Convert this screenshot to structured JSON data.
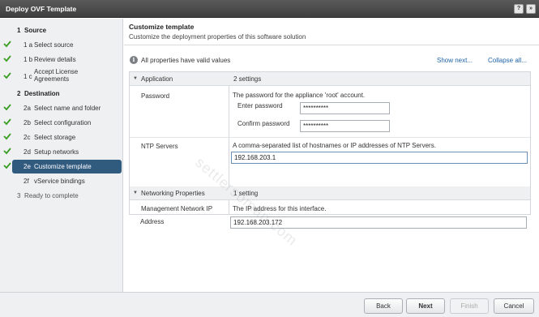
{
  "window": {
    "title": "Deploy OVF Template",
    "help_glyph": "?",
    "close_glyph": "»"
  },
  "steps": [
    {
      "num": "1",
      "label": "Source",
      "kind": "head",
      "checked": false
    },
    {
      "num": "1 a",
      "label": "Select source",
      "kind": "sub",
      "checked": true
    },
    {
      "num": "1 b",
      "label": "Review details",
      "kind": "sub",
      "checked": true
    },
    {
      "num": "1 c",
      "label": "Accept License Agreements",
      "kind": "sub",
      "checked": true
    },
    {
      "num": "2",
      "label": "Destination",
      "kind": "head",
      "checked": false
    },
    {
      "num": "2a",
      "label": "Select name and folder",
      "kind": "sub",
      "checked": true
    },
    {
      "num": "2b",
      "label": "Select configuration",
      "kind": "sub",
      "checked": true
    },
    {
      "num": "2c",
      "label": "Select storage",
      "kind": "sub",
      "checked": true
    },
    {
      "num": "2d",
      "label": "Setup networks",
      "kind": "sub",
      "checked": true
    },
    {
      "num": "2e",
      "label": "Customize template",
      "kind": "sub",
      "checked": true,
      "active": true
    },
    {
      "num": "2f",
      "label": "vService bindings",
      "kind": "sub",
      "checked": false
    },
    {
      "num": "3",
      "label": "Ready to complete",
      "kind": "head",
      "checked": false,
      "disabled": true
    }
  ],
  "main": {
    "title": "Customize template",
    "subtitle": "Customize the deployment properties of this software solution",
    "valid_text": "All properties have valid values",
    "show_next": "Show next...",
    "collapse_all": "Collapse all..."
  },
  "properties": {
    "application": {
      "label": "Application",
      "count": "2 settings",
      "password": {
        "label": "Password",
        "description": "The password for the appliance 'root' account.",
        "enter_label": "Enter password",
        "enter_value": "**********",
        "confirm_label": "Confirm password",
        "confirm_value": "**********"
      },
      "ntp": {
        "label": "NTP Servers",
        "description": "A comma-separated list of hostnames or IP addresses of NTP Servers.",
        "value": "192.168.203.1"
      }
    },
    "networking": {
      "label": "Networking Properties",
      "count": "1 setting",
      "mgmt_ip": {
        "label_line1": "Management Network IP",
        "label_line2": "Address",
        "description": "The IP address for this interface.",
        "value": "192.168.203.172"
      }
    }
  },
  "footer": {
    "back": "Back",
    "next": "Next",
    "finish": "Finish",
    "cancel": "Cancel"
  },
  "watermark": "settlersoman.com",
  "colors": {
    "accent": "#315a7f",
    "link": "#1f63a6",
    "check": "#3a9d23"
  }
}
